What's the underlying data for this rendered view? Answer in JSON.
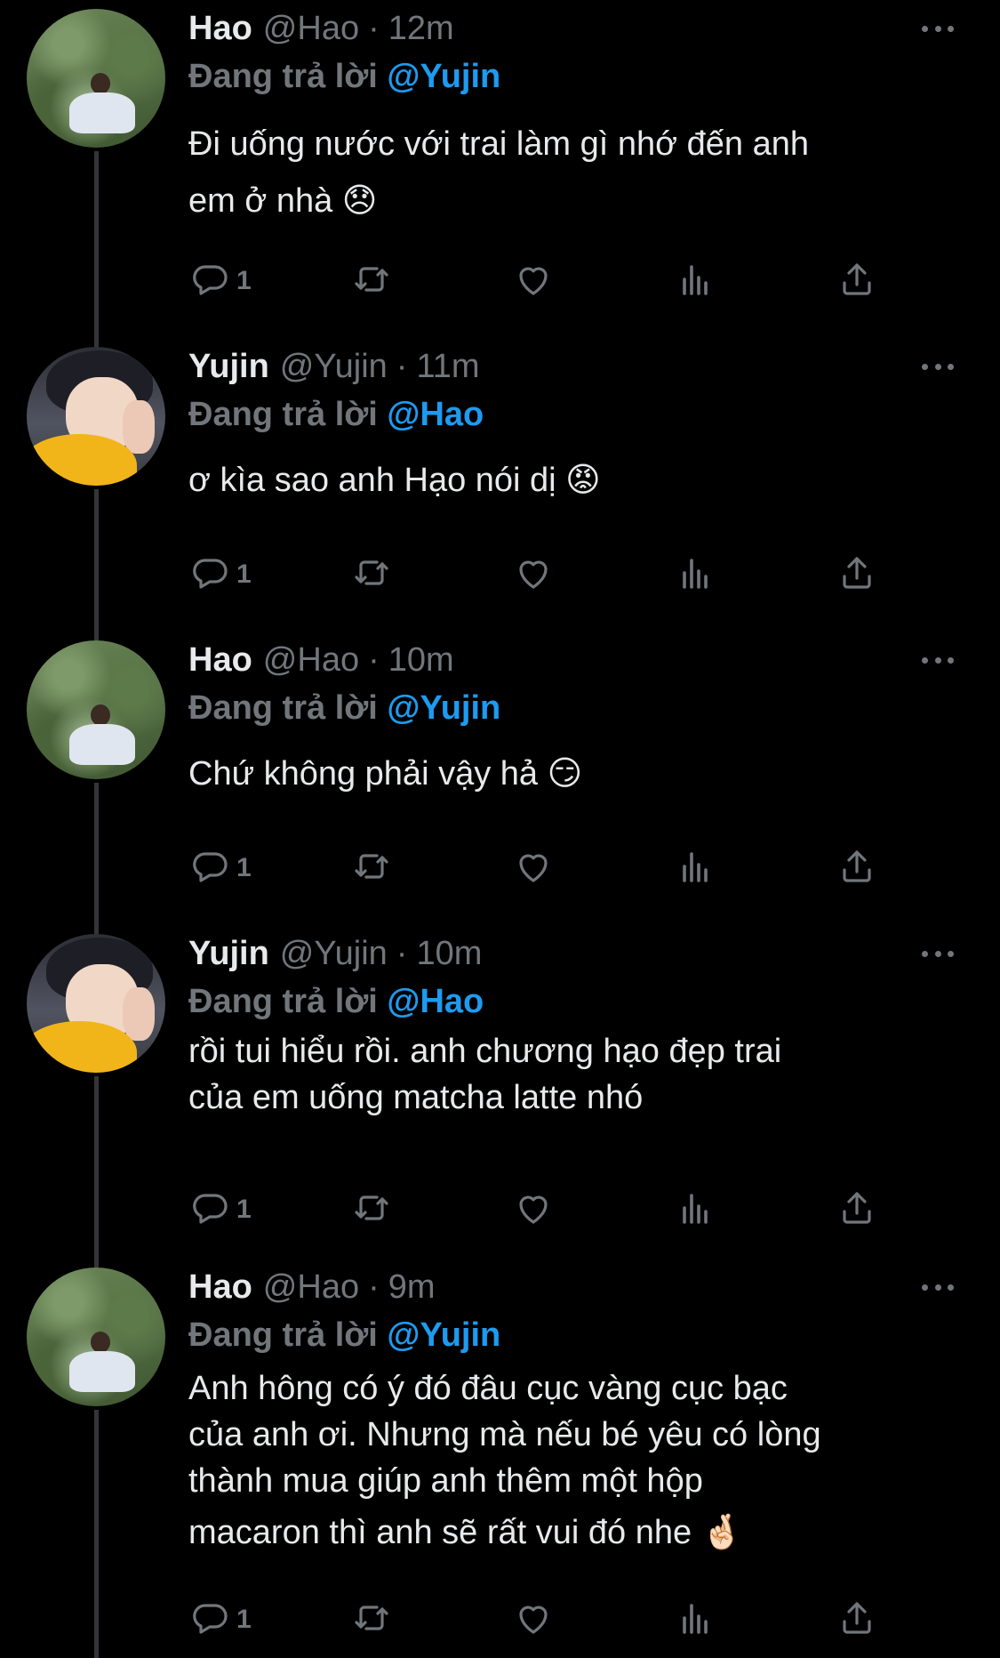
{
  "labels": {
    "replying_to": "Đang trả lời"
  },
  "colors": {
    "background": "#000000",
    "text": "#e7e9ea",
    "secondary": "#71767b",
    "mention": "#1d9bf0"
  },
  "tweets": [
    {
      "name": "Hao",
      "handle": "@Hao",
      "time": "12m",
      "replying_to": "@Yujin",
      "lines": [
        "Đi uống nước với trai làm gì nhớ đến anh",
        "em ở nhà 😞"
      ],
      "reply_count": "1",
      "avatar": "hao"
    },
    {
      "name": "Yujin",
      "handle": "@Yujin",
      "time": "11m",
      "replying_to": "@Hao",
      "lines": [
        "ơ kìa sao anh Hạo nói dị 😡"
      ],
      "reply_count": "1",
      "avatar": "yujin"
    },
    {
      "name": "Hao",
      "handle": "@Hao",
      "time": "10m",
      "replying_to": "@Yujin",
      "lines": [
        "Chứ không phải vậy hả 😏"
      ],
      "reply_count": "1",
      "avatar": "hao"
    },
    {
      "name": "Yujin",
      "handle": "@Yujin",
      "time": "10m",
      "replying_to": "@Hao",
      "lines": [
        "rồi tui hiểu rồi. anh chương hạo đẹp trai",
        "của em uống matcha latte nhó"
      ],
      "reply_count": "1",
      "avatar": "yujin"
    },
    {
      "name": "Hao",
      "handle": "@Hao",
      "time": "9m",
      "replying_to": "@Yujin",
      "lines": [
        "Anh hông có ý đó đâu cục vàng cục bạc",
        "của anh ơi. Nhưng mà nếu bé yêu có lòng",
        "thành mua giúp anh thêm một hộp",
        "macaron thì anh sẽ rất vui đó nhe 🤞🏻"
      ],
      "reply_count": "1",
      "avatar": "hao"
    }
  ]
}
